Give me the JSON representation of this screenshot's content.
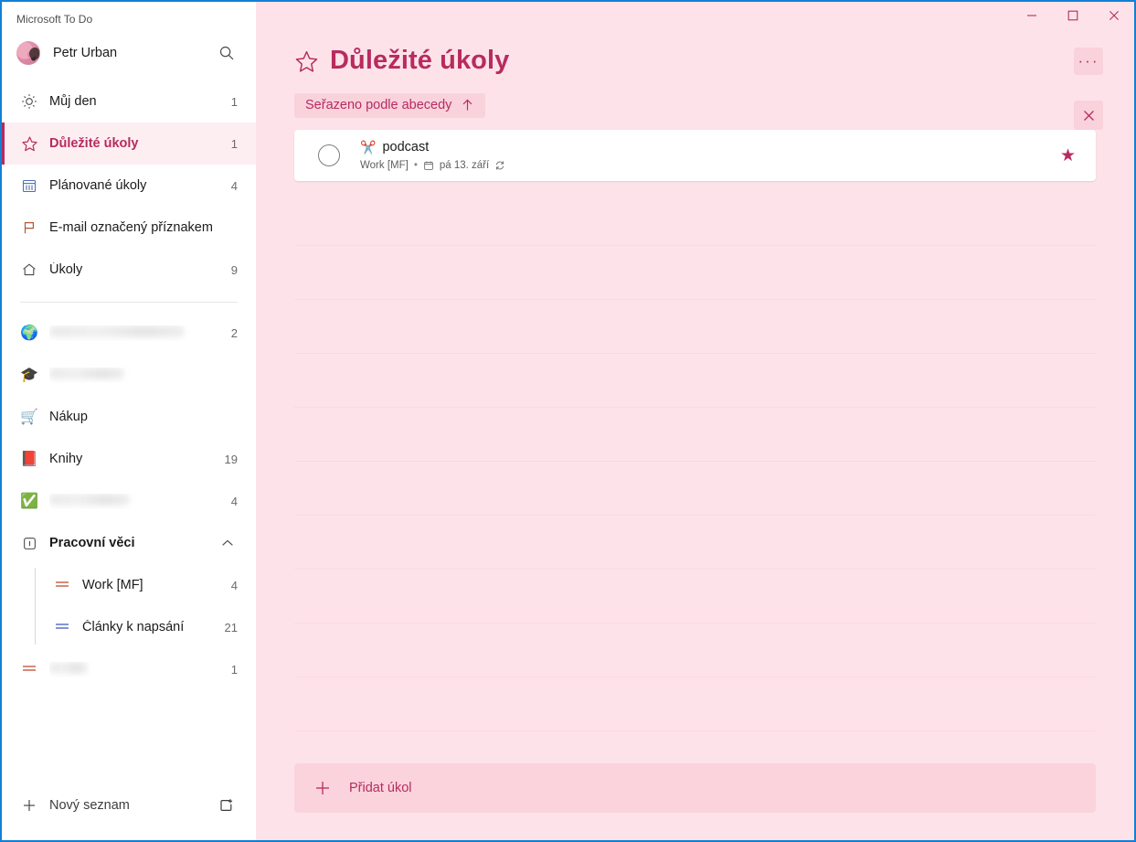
{
  "window": {
    "app_title": "Microsoft To Do",
    "controls": {
      "minimize": "minimize-button",
      "maximize": "maximize-button",
      "close": "close-button"
    }
  },
  "sidebar": {
    "account": {
      "name": "Petr Urban",
      "search_icon": "search-icon",
      "avatar": "avatar"
    },
    "smart_lists": [
      {
        "icon": "sun-icon",
        "label": "Můj den",
        "count": "1",
        "selected": false,
        "blurred": false
      },
      {
        "icon": "star-icon",
        "label": "Důležité úkoly",
        "count": "1",
        "selected": true,
        "blurred": false
      },
      {
        "icon": "calendar-icon",
        "label": "Plánované úkoly",
        "count": "4",
        "selected": false,
        "blurred": false
      },
      {
        "icon": "flag-icon",
        "label": "E-mail označený příznakem",
        "count": "",
        "selected": false,
        "blurred": false
      },
      {
        "icon": "home-icon",
        "label": "Úkoly",
        "count": "9",
        "selected": false,
        "blurred": false
      }
    ],
    "user_lists": [
      {
        "icon": "globe-emoji",
        "label": "",
        "count": "2",
        "blurred": true,
        "blur_width": "w1"
      },
      {
        "icon": "graduation-emoji",
        "label": "",
        "count": "",
        "blurred": true,
        "blur_width": "w2"
      },
      {
        "icon": "cart-emoji",
        "label": "Nákup",
        "count": "",
        "blurred": false
      },
      {
        "icon": "book-emoji",
        "label": "Knihy",
        "count": "19",
        "blurred": false
      },
      {
        "icon": "checkmark-emoji",
        "label": "",
        "count": "4",
        "blurred": true,
        "blur_width": "w3"
      }
    ],
    "group": {
      "icon": "group-icon",
      "label": "Pracovní věci",
      "expanded": true,
      "chevron": "chevron-up-icon",
      "items": [
        {
          "icon": "list-icon-red",
          "label": "Work [MF]",
          "count": "4",
          "blurred": false
        },
        {
          "icon": "list-icon-blue",
          "label": "Články k napsání",
          "count": "21",
          "blurred": false
        }
      ]
    },
    "loose_list": {
      "icon": "list-icon-red",
      "label": "",
      "count": "1",
      "blurred": true,
      "blur_width": "w4"
    },
    "footer": {
      "new_list_label": "Nový seznam",
      "new_list_icon": "plus-icon",
      "new_group_icon": "new-group-icon"
    }
  },
  "main": {
    "title": "Důležité úkoly",
    "title_icon": "star-icon",
    "more_label": "···",
    "sort_chip": {
      "label": "Seřazeno podle abecedy",
      "direction_icon": "arrow-up-icon"
    },
    "close_sort_icon": "close-icon",
    "tasks": [
      {
        "emoji": "✂️",
        "title": "podcast",
        "list_name": "Work [MF]",
        "separator": "•",
        "due_icon": "calendar-icon",
        "due_date": "pá 13. září",
        "repeat_icon": "repeat-icon",
        "starred": true,
        "star_icon": "star-filled-icon",
        "checkbox": "checkbox-unchecked"
      }
    ],
    "add_task": {
      "label": "Přidat úkol",
      "icon": "plus-icon"
    },
    "empty_row_count": 11
  },
  "colors": {
    "accent": "#b72b5f",
    "main_bg": "#fde3e9",
    "chip_bg": "#f9d2dc",
    "add_task_bg": "#fbd3dc",
    "window_border": "#1280d5",
    "row_line": "#fbd9e0"
  }
}
